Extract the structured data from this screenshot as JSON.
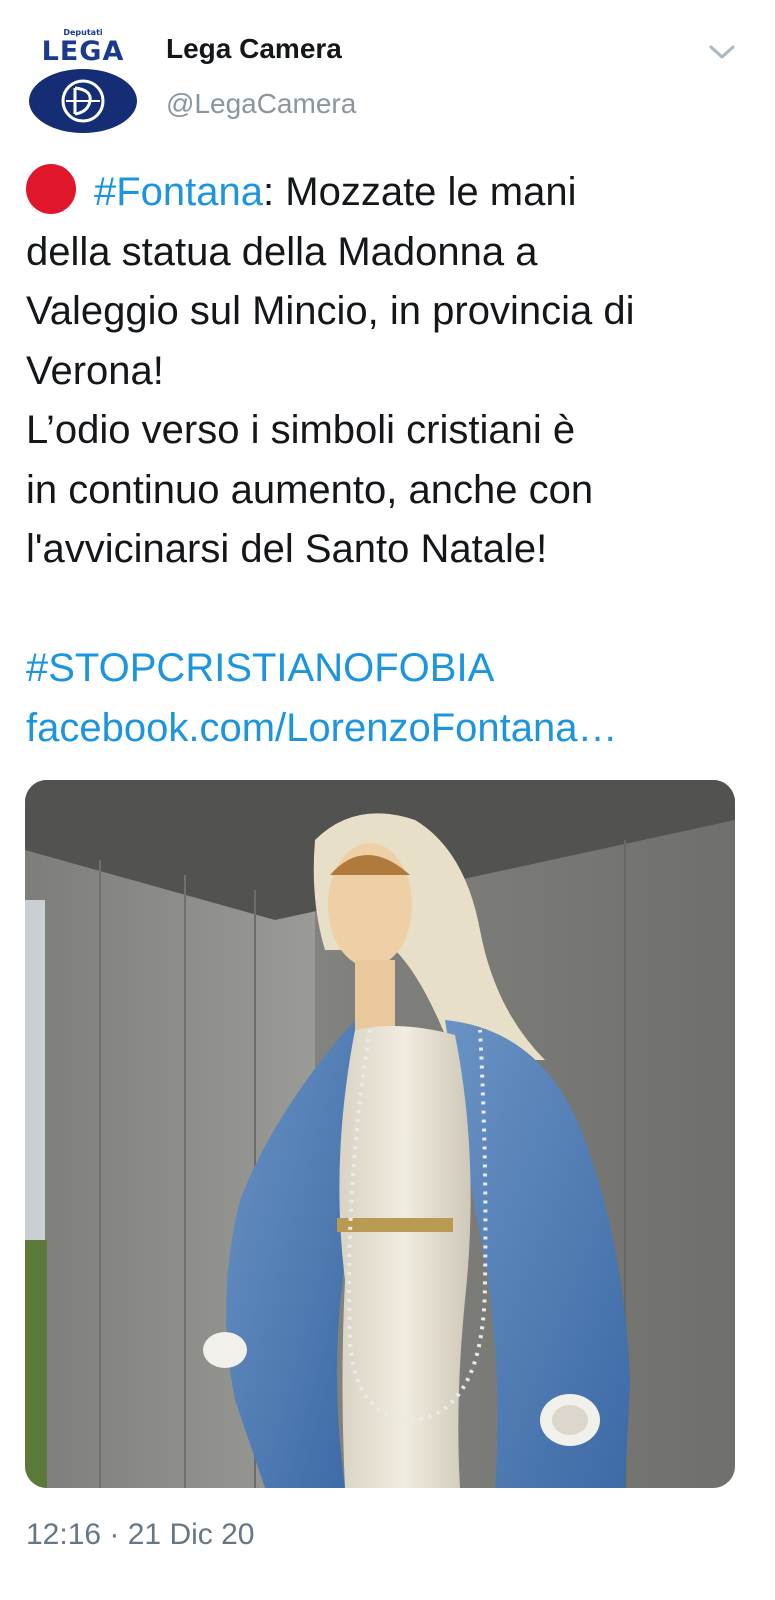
{
  "author": {
    "avatar_brand_small": "Deputati",
    "avatar_brand": "LEGA",
    "name": "Lega Camera",
    "handle": "@LegaCamera"
  },
  "tweet": {
    "emoji_icon": "red-circle",
    "hashtag_fontana": "#Fontana",
    "line1_rest": ": Mozzate le mani",
    "line2": "della statua della Madonna a",
    "line3": "Valeggio sul Mincio, in provincia di",
    "line4": "Verona!",
    "line5": "L’odio verso i simboli cristiani è",
    "line6": "in continuo aumento, anche con",
    "line7": "l'avvicinarsi del Santo Natale!",
    "hashtag_stop": "#STOPCRISTIANOFOBIA",
    "link": "facebook.com/LorenzoFontana…"
  },
  "media": {
    "icon": "photo-statue-madonna"
  },
  "timestamp": "12:16 · 21 Dic 20",
  "colors": {
    "link": "#1b95e0",
    "dot": "#e0162b",
    "brand": "#1a3a8f"
  }
}
